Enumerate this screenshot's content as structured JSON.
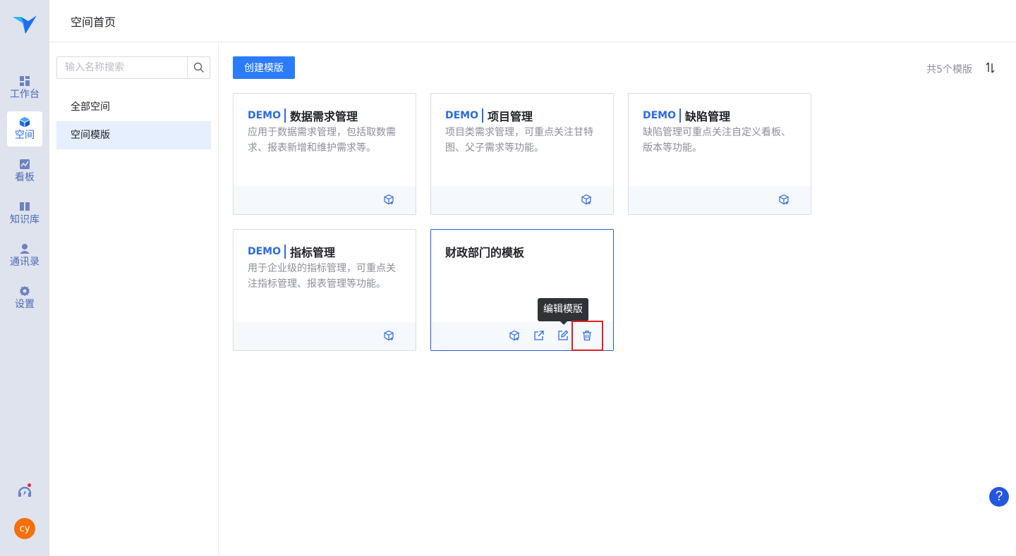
{
  "rail": {
    "items": [
      {
        "label": "工作台",
        "icon": "dashboard-icon"
      },
      {
        "label": "空间",
        "icon": "cube-icon",
        "active": true
      },
      {
        "label": "看板",
        "icon": "chart-board-icon"
      },
      {
        "label": "知识库",
        "icon": "book-icon"
      },
      {
        "label": "通讯录",
        "icon": "person-icon"
      },
      {
        "label": "设置",
        "icon": "gear-icon"
      }
    ],
    "avatar_text": "cy"
  },
  "header": {
    "title": "空间首页"
  },
  "sidebar": {
    "search_placeholder": "输入名称搜索",
    "items": [
      {
        "label": "全部空间"
      },
      {
        "label": "空间模版",
        "active": true
      }
    ]
  },
  "main": {
    "create_label": "创建模版",
    "total_text": "共5个模版",
    "cards": [
      {
        "demo": "DEMO",
        "title": "数据需求管理",
        "desc": "应用于数据需求管理，包括取数需求、报表新增和维护需求等。"
      },
      {
        "demo": "DEMO",
        "title": "项目管理",
        "desc": "项目类需求管理，可重点关注甘特图、父子需求等功能。"
      },
      {
        "demo": "DEMO",
        "title": "缺陷管理",
        "desc": "缺陷管理可重点关注自定义看板、版本等功能。"
      },
      {
        "demo": "DEMO",
        "title": "指标管理",
        "desc": "用于企业级的指标管理，可重点关注指标管理、报表管理等功能。"
      },
      {
        "demo": "",
        "title": "财政部门的模板",
        "desc": ""
      }
    ],
    "tooltip": "编辑模版"
  },
  "help_label": "?",
  "colors": {
    "primary": "#2b7bfb",
    "rail_bg": "#dfe3ee",
    "highlight": "#e02020"
  }
}
